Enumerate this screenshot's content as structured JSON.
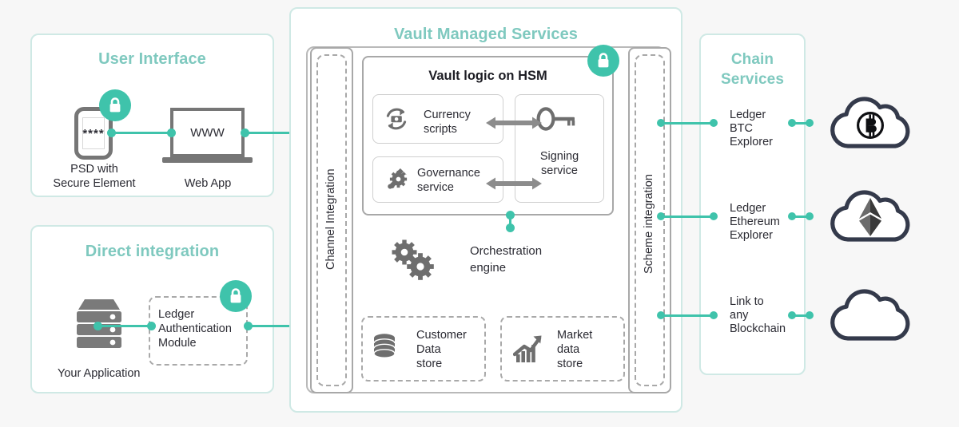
{
  "diagram": {
    "background_color": "#f7f7f7",
    "accent_color": "#3fc3ab",
    "title_color": "#7fc9bf",
    "gray_color": "#767676"
  },
  "user_interface": {
    "title": "User Interface",
    "psd": {
      "screen_text": "****",
      "caption_line1": "PSD with",
      "caption_line2": "Secure Element",
      "lock_icon": "lock-icon"
    },
    "web_app": {
      "screen_text": "WWW",
      "caption": "Web App"
    }
  },
  "direct_integration": {
    "title": "Direct integration",
    "server": {
      "icon": "server-stack-icon",
      "caption": "Your Application"
    },
    "module": {
      "line1": "Ledger",
      "line2": "Authentication",
      "line3": "Module",
      "lock_icon": "lock-icon"
    }
  },
  "vault": {
    "title": "Vault Managed Services",
    "channel_integration_label": "Channel Integration",
    "scheme_integration_label": "Scheme integration",
    "hsm": {
      "title": "Vault logic on HSM",
      "lock_icon": "lock-icon",
      "currency_scripts": {
        "icon": "currency-refresh-icon",
        "line1": "Currency",
        "line2": "scripts"
      },
      "governance_service": {
        "icon": "wrench-gear-icon",
        "line1": "Governance",
        "line2": "service"
      },
      "signing_service": {
        "icon": "key-icon",
        "line1": "Signing",
        "line2": "service"
      },
      "arrow_top": "double-arrow-icon",
      "arrow_bottom": "double-arrow-icon"
    },
    "orchestration": {
      "icon": "gears-icon",
      "line1": "Orchestration",
      "line2": "engine"
    },
    "customer_data_store": {
      "icon": "database-icon",
      "line1": "Customer",
      "line2": "Data",
      "line3": "store"
    },
    "market_data_store": {
      "icon": "chart-arrow-icon",
      "line1": "Market",
      "line2": "data",
      "line3": "store"
    }
  },
  "chain_services": {
    "title_line1": "Chain",
    "title_line2": "Services",
    "entries": [
      {
        "line1": "Ledger",
        "line2": "BTC",
        "line3": "Explorer",
        "cloud_icon": "bitcoin-cloud-icon"
      },
      {
        "line1": "Ledger",
        "line2": "Ethereum",
        "line3": "Explorer",
        "cloud_icon": "ethereum-cloud-icon"
      },
      {
        "line1": "Link to",
        "line2": "any",
        "line3": "Blockchain",
        "cloud_icon": "blank-cloud-icon"
      }
    ]
  }
}
